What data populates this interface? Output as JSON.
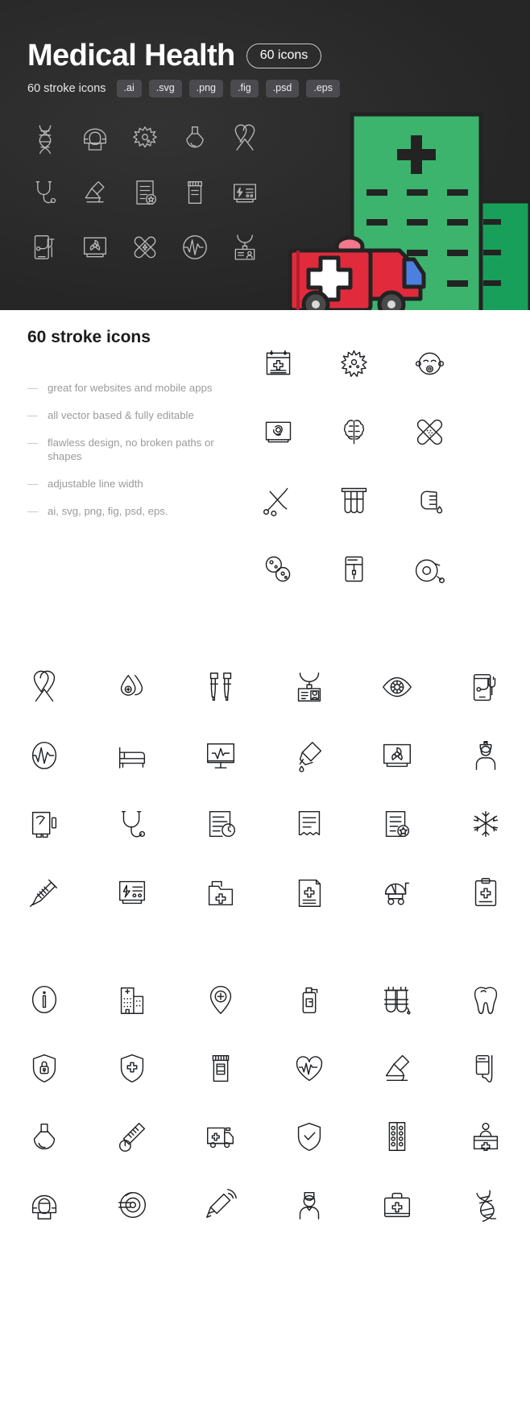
{
  "hero": {
    "title": "Medical Health",
    "count_pill": "60 icons",
    "subtitle": "60 stroke icons",
    "formats": [
      ".ai",
      ".svg",
      ".png",
      ".fig",
      ".psd",
      ".eps"
    ],
    "bg_color": "#2b2b2b",
    "icon_stroke_color": "#b9b9bb",
    "icons_row1": [
      "dna-icon",
      "mri-scanner-icon",
      "virus-icon",
      "flask-icon",
      "awareness-ribbon-icon"
    ],
    "icons_row2": [
      "stethoscope-icon",
      "microscope-icon",
      "certificate-document-icon",
      "pill-bottle-icon",
      "defibrillator-icon"
    ],
    "icons_row3": [
      "mobile-health-icon",
      "radiology-monitor-icon",
      "crossed-bandages-icon",
      "pulse-circle-icon",
      "id-badge-icon"
    ],
    "illustration": {
      "hospital_building_color": "#3cb46e",
      "hospital_building_side_color": "#18a05a",
      "ambulance_body_color": "#e12b3c",
      "ambulance_window_color": "#4d7fe0",
      "ambulance_light_color": "#f2788c",
      "outline_color": "#232323",
      "cross_color": "#232323",
      "ambulance_cross_color": "#ffffff"
    }
  },
  "info": {
    "title": "60 stroke icons",
    "bullets": [
      "great for websites and mobile apps",
      "all vector based & fully editable",
      "flawless design, no broken paths or shapes",
      "adjustable line width",
      "ai, svg, png, fig, psd, eps."
    ],
    "bullet_marker": "—",
    "icons": [
      "medical-calendar-icon",
      "virus-icon",
      "baby-face-icon",
      "ultrasound-monitor-icon",
      "brain-icon",
      "crossed-bandages-icon",
      "surgical-scissors-icon",
      "test-tubes-icon",
      "blood-finger-prick-icon",
      "bacteria-cells-icon",
      "iv-drip-bag-icon",
      "wheelchair-icon"
    ]
  },
  "grid_a": {
    "icons": [
      "awareness-ribbon-icon",
      "blood-drops-icon",
      "crutches-icon",
      "id-badge-necklace-icon",
      "eye-icon",
      "mobile-health-icon",
      "pulse-oval-icon",
      "hospital-bed-icon",
      "heartbeat-monitor-icon",
      "dropper-bottle-icon",
      "radiology-monitor-icon",
      "doctor-portrait-icon",
      "xray-film-icon",
      "stethoscope-icon",
      "medical-report-clock-icon",
      "receipt-icon",
      "certificate-document-icon",
      "snowflake-icon",
      "syringe-icon",
      "defibrillator-icon",
      "medical-folder-icon",
      "prescription-document-icon",
      "baby-stroller-icon",
      "medical-clipboard-icon"
    ]
  },
  "grid_b": {
    "icons": [
      "info-circle-icon",
      "hospital-building-icon",
      "medical-location-pin-icon",
      "sanitizer-pump-icon",
      "oxygen-tanks-icon",
      "tooth-icon",
      "shield-lock-icon",
      "shield-cross-icon",
      "pill-bottle-icon",
      "heart-pulse-icon",
      "microscope-icon",
      "iv-drip-bag-icon",
      "flask-icon",
      "thermometer-icon",
      "ambulance-icon",
      "shield-check-icon",
      "pill-blister-pack-icon",
      "reception-desk-icon",
      "mri-scanner-icon",
      "ct-scanner-icon",
      "otoscope-icon",
      "nurse-portrait-icon",
      "first-aid-kit-icon",
      "dna-icon"
    ]
  }
}
